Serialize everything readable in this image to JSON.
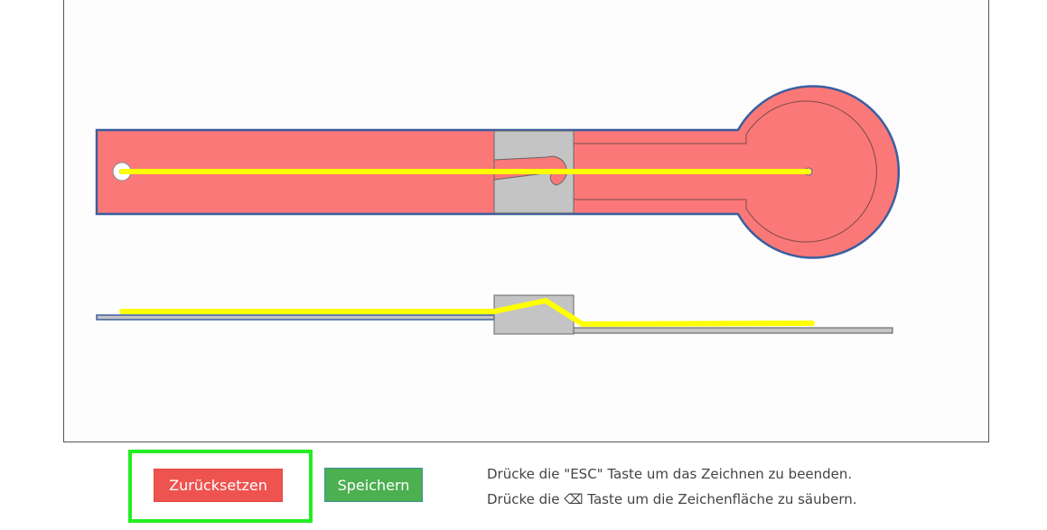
{
  "drawing_canvas": {
    "description_label": ""
  },
  "buttons": {
    "reset_label": "Zurücksetzen",
    "save_label": "Speichern"
  },
  "hints": {
    "esc_hint": "Drücke die \"ESC\" Taste um das Zeichnen zu beenden.",
    "clear_hint": "Drücke die ⌫ Taste um die Zeichenfläche zu säubern."
  },
  "colors": {
    "part_fill": "#fb7878",
    "part_outline": "#3a5fa0",
    "connector_fill": "#c4c4c4",
    "drawn_line": "#ffff00",
    "reset_button": "#ef5350",
    "save_button": "#4caf50",
    "highlight": "#22ee22"
  }
}
